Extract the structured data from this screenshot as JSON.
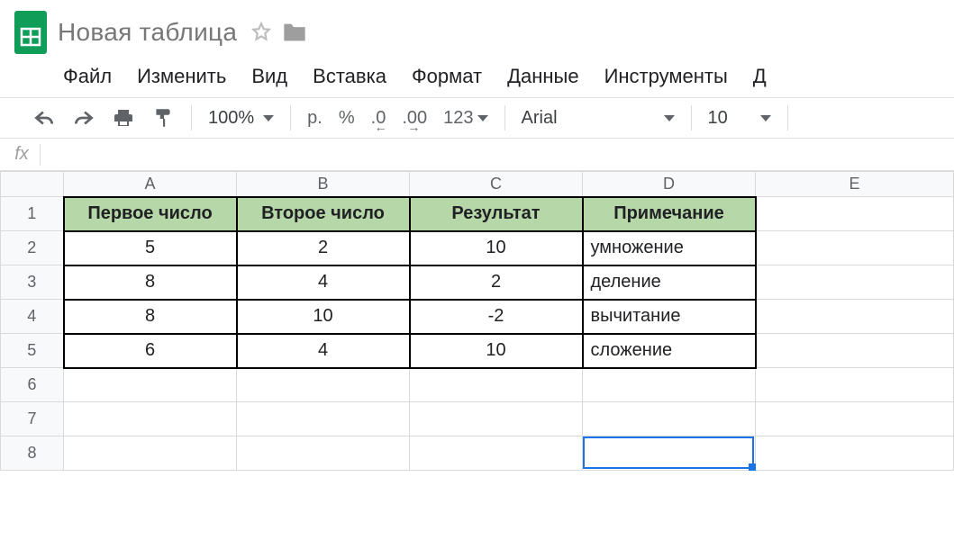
{
  "header": {
    "doc_title": "Новая таблица"
  },
  "menu": {
    "file": "Файл",
    "edit": "Изменить",
    "view": "Вид",
    "insert": "Вставка",
    "format": "Формат",
    "data": "Данные",
    "tools": "Инструменты",
    "addons_partial": "Д"
  },
  "toolbar": {
    "zoom": "100%",
    "currency": "р.",
    "percent": "%",
    "dec_less": ".0",
    "dec_more": ".00",
    "numfmt": "123",
    "font": "Arial",
    "font_size": "10"
  },
  "formula_bar": {
    "fx": "fx",
    "value": ""
  },
  "columns": [
    "A",
    "B",
    "C",
    "D",
    "E"
  ],
  "rows": [
    "1",
    "2",
    "3",
    "4",
    "5",
    "6",
    "7",
    "8"
  ],
  "table": {
    "headers": {
      "A": "Первое число",
      "B": "Второе число",
      "C": "Результат",
      "D": "Примечание"
    },
    "rows": [
      {
        "A": "5",
        "B": "2",
        "C": "10",
        "D": "умножение"
      },
      {
        "A": "8",
        "B": "4",
        "C": "2",
        "D": "деление"
      },
      {
        "A": "8",
        "B": "10",
        "C": "-2",
        "D": "вычитание"
      },
      {
        "A": "6",
        "B": "4",
        "C": "10",
        "D": "сложение"
      }
    ]
  },
  "selection": {
    "cell": "D8"
  }
}
